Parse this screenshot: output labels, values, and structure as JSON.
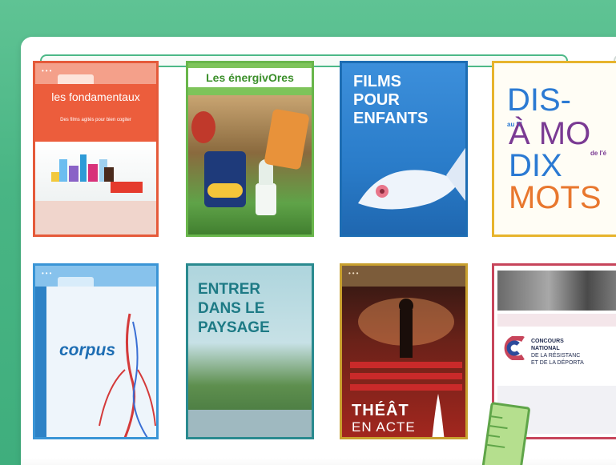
{
  "tiles": [
    {
      "title": "les fondamentaux",
      "subtitle": "Des films agités pour bien cogiter"
    },
    {
      "title": "Les énergivOres"
    },
    {
      "title": "FILMS\nPOUR\nENFANTS"
    },
    {
      "lines": [
        "DIS-",
        "au fil",
        "À MO",
        "de l'é",
        "DIX",
        "MOTS"
      ]
    },
    {
      "title": "corpus"
    },
    {
      "title": "ENTRER\nDANS LE\nPAYSAGE"
    },
    {
      "title": "THÉÂT",
      "subtitle": "EN ACTE"
    },
    {
      "lines": [
        "CONCOURS",
        "NATIONAL",
        "DE LA RÉSISTANC",
        "ET DE LA DÉPORTA"
      ]
    }
  ],
  "colors": {
    "background": "#4db786",
    "accent": "#4cb887"
  },
  "icons": [
    "ruler-icon"
  ]
}
